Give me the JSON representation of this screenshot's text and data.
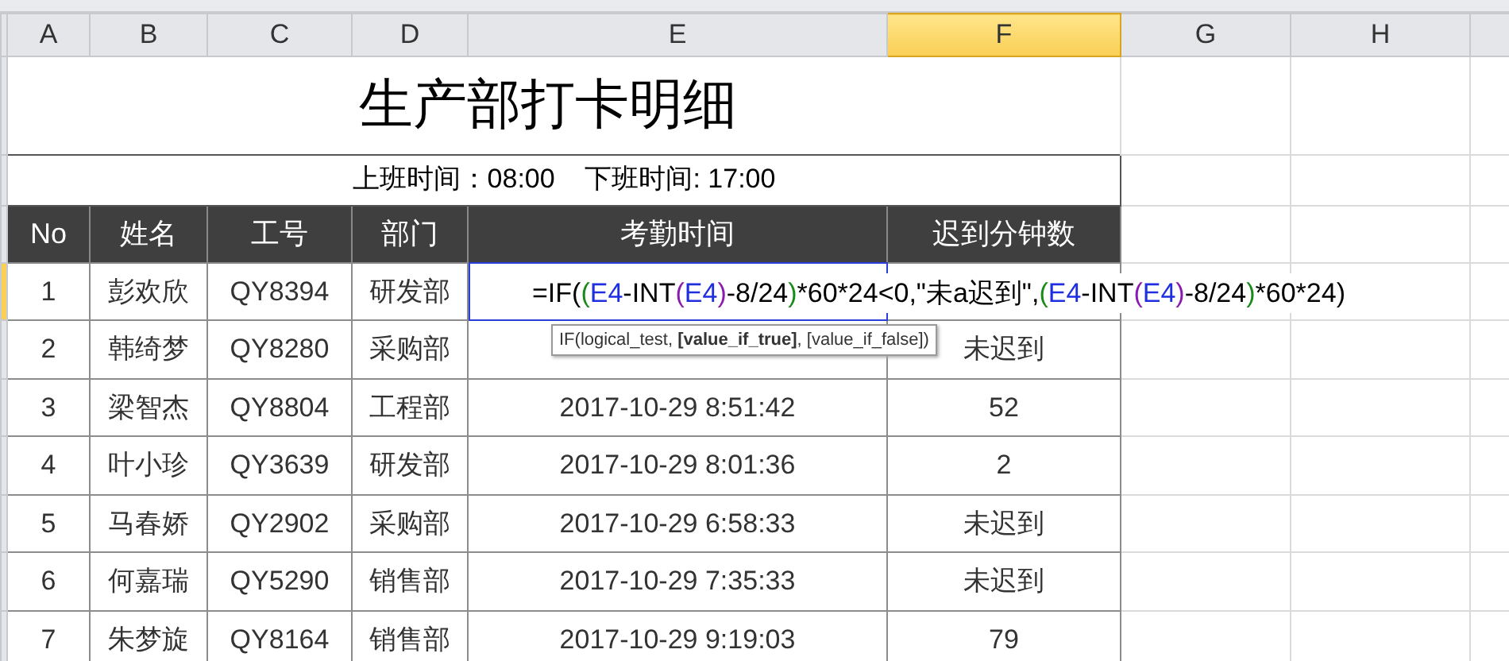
{
  "column_headers": [
    {
      "label": "A",
      "selected": false
    },
    {
      "label": "B",
      "selected": false
    },
    {
      "label": "C",
      "selected": false
    },
    {
      "label": "D",
      "selected": false
    },
    {
      "label": "E",
      "selected": false
    },
    {
      "label": "F",
      "selected": true
    },
    {
      "label": "G",
      "selected": false
    },
    {
      "label": "H",
      "selected": false
    }
  ],
  "title": "生产部打卡明细",
  "subtitle": "上班时间：08:00    下班时间: 17:00",
  "table": {
    "headers": [
      "No",
      "姓名",
      "工号",
      "部门",
      "考勤时间",
      "迟到分钟数"
    ],
    "rows": [
      {
        "selected": true,
        "no": "1",
        "name": "彭欢欣",
        "id": "QY8394",
        "dept": "研发部",
        "formula": [
          {
            "text": "=IF(",
            "color": "#000000"
          },
          {
            "text": "(",
            "color": "#1a8a1a"
          },
          {
            "text": "E4",
            "color": "#1f2fe0"
          },
          {
            "text": "-INT",
            "color": "#000000"
          },
          {
            "text": "(",
            "color": "#8a1ab0"
          },
          {
            "text": "E4",
            "color": "#1f2fe0"
          },
          {
            "text": ")",
            "color": "#8a1ab0"
          },
          {
            "text": "-8/24",
            "color": "#000000"
          },
          {
            "text": ")",
            "color": "#1a8a1a"
          },
          {
            "text": "*60*24<0,\"未a迟到\",",
            "color": "#000000"
          },
          {
            "text": "(",
            "color": "#1a8a1a"
          },
          {
            "text": "E4",
            "color": "#1f2fe0"
          },
          {
            "text": "-INT",
            "color": "#000000"
          },
          {
            "text": "(",
            "color": "#8a1ab0"
          },
          {
            "text": "E4",
            "color": "#1f2fe0"
          },
          {
            "text": ")",
            "color": "#8a1ab0"
          },
          {
            "text": "-8/24",
            "color": "#000000"
          },
          {
            "text": ")",
            "color": "#1a8a1a"
          },
          {
            "text": "*60*24)",
            "color": "#000000"
          }
        ]
      },
      {
        "selected": false,
        "no": "2",
        "name": "韩绮梦",
        "id": "QY8280",
        "dept": "采购部",
        "late": "未迟到"
      },
      {
        "selected": false,
        "no": "3",
        "name": "梁智杰",
        "id": "QY8804",
        "dept": "工程部",
        "time": "2017-10-29 8:51:42",
        "late": "52"
      },
      {
        "selected": false,
        "no": "4",
        "name": "叶小珍",
        "id": "QY3639",
        "dept": "研发部",
        "time": "2017-10-29 8:01:36",
        "late": "2"
      },
      {
        "selected": false,
        "no": "5",
        "name": "马春娇",
        "id": "QY2902",
        "dept": "采购部",
        "time": "2017-10-29 6:58:33",
        "late": "未迟到"
      },
      {
        "selected": false,
        "no": "6",
        "name": "何嘉瑞",
        "id": "QY5290",
        "dept": "销售部",
        "time": "2017-10-29 7:35:33",
        "late": "未迟到"
      },
      {
        "selected": false,
        "no": "7",
        "name": "朱梦旋",
        "id": "QY8164",
        "dept": "销售部",
        "time": "2017-10-29 9:19:03",
        "late": "79"
      }
    ]
  },
  "tooltip": "IF(logical_test, **[value_if_true]**, [value_if_false])"
}
